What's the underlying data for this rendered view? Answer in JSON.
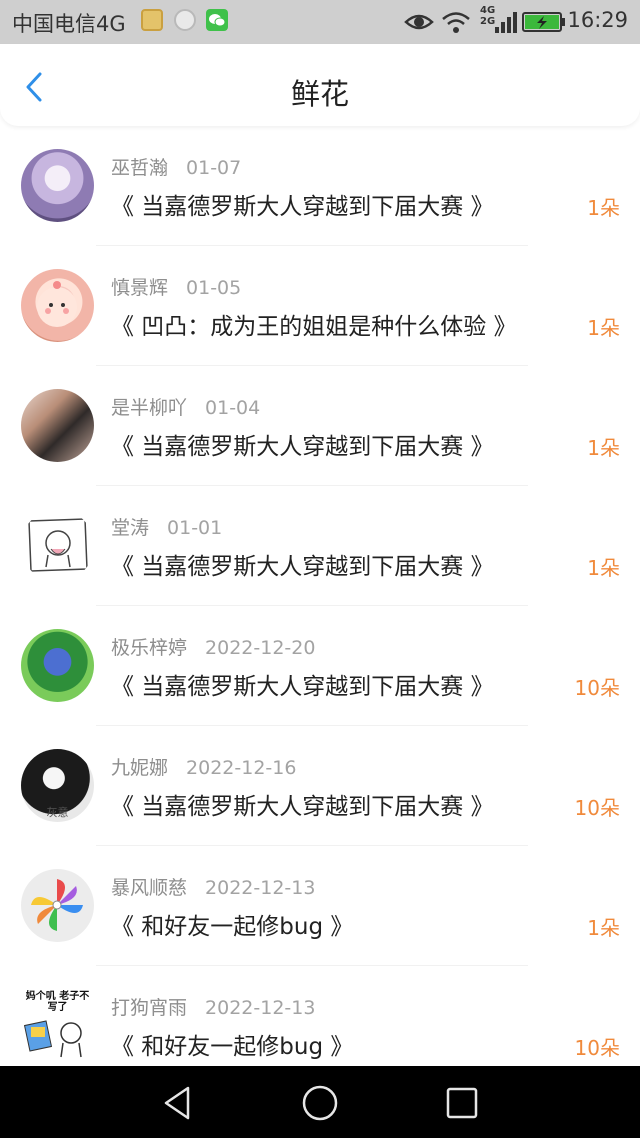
{
  "status_bar": {
    "carrier": "中国电信4G",
    "net_label_top": "4G",
    "net_label_bottom": "2G",
    "time": "16:29",
    "icons": [
      "gallery-notification-icon",
      "camera-notification-icon",
      "wechat-notification-icon",
      "eye-icon",
      "wifi-icon",
      "signal-icon",
      "battery-charging-icon"
    ]
  },
  "header": {
    "title": "鲜花",
    "back_icon": "chevron-left-icon",
    "accent_color": "#2f8fe8"
  },
  "list": [
    {
      "name": "巫哲瀚",
      "date": "01-07",
      "title": "《 当嘉德罗斯大人穿越到下届大赛 》",
      "count": "1朵"
    },
    {
      "name": "慎景辉",
      "date": "01-05",
      "title": "《 凹凸：成为王的姐姐是种什么体验 》",
      "count": "1朵"
    },
    {
      "name": "是半柳吖",
      "date": "01-04",
      "title": "《 当嘉德罗斯大人穿越到下届大赛 》",
      "count": "1朵"
    },
    {
      "name": "堂涛",
      "date": "01-01",
      "title": "《 当嘉德罗斯大人穿越到下届大赛 》",
      "count": "1朵"
    },
    {
      "name": "极乐梓婷",
      "date": "2022-12-20",
      "title": "《 当嘉德罗斯大人穿越到下届大赛 》",
      "count": "10朵"
    },
    {
      "name": "九妮娜",
      "date": "2022-12-16",
      "title": "《 当嘉德罗斯大人穿越到下届大赛 》",
      "count": "10朵",
      "avatar_text": "灰意"
    },
    {
      "name": "暴风顺慈",
      "date": "2022-12-13",
      "title": "《 和好友一起修bug 》",
      "count": "1朵"
    },
    {
      "name": "打狗宵雨",
      "date": "2022-12-13",
      "title": "《 和好友一起修bug 》",
      "count": "10朵",
      "avatar_text": "妈个叽 老子不写了"
    }
  ],
  "colors": {
    "count": "#f08a3c",
    "name": "#8e8e8e",
    "title": "#222222"
  },
  "nav_bar": {
    "icons": [
      "back-triangle-icon",
      "home-circle-icon",
      "recents-square-icon"
    ]
  }
}
